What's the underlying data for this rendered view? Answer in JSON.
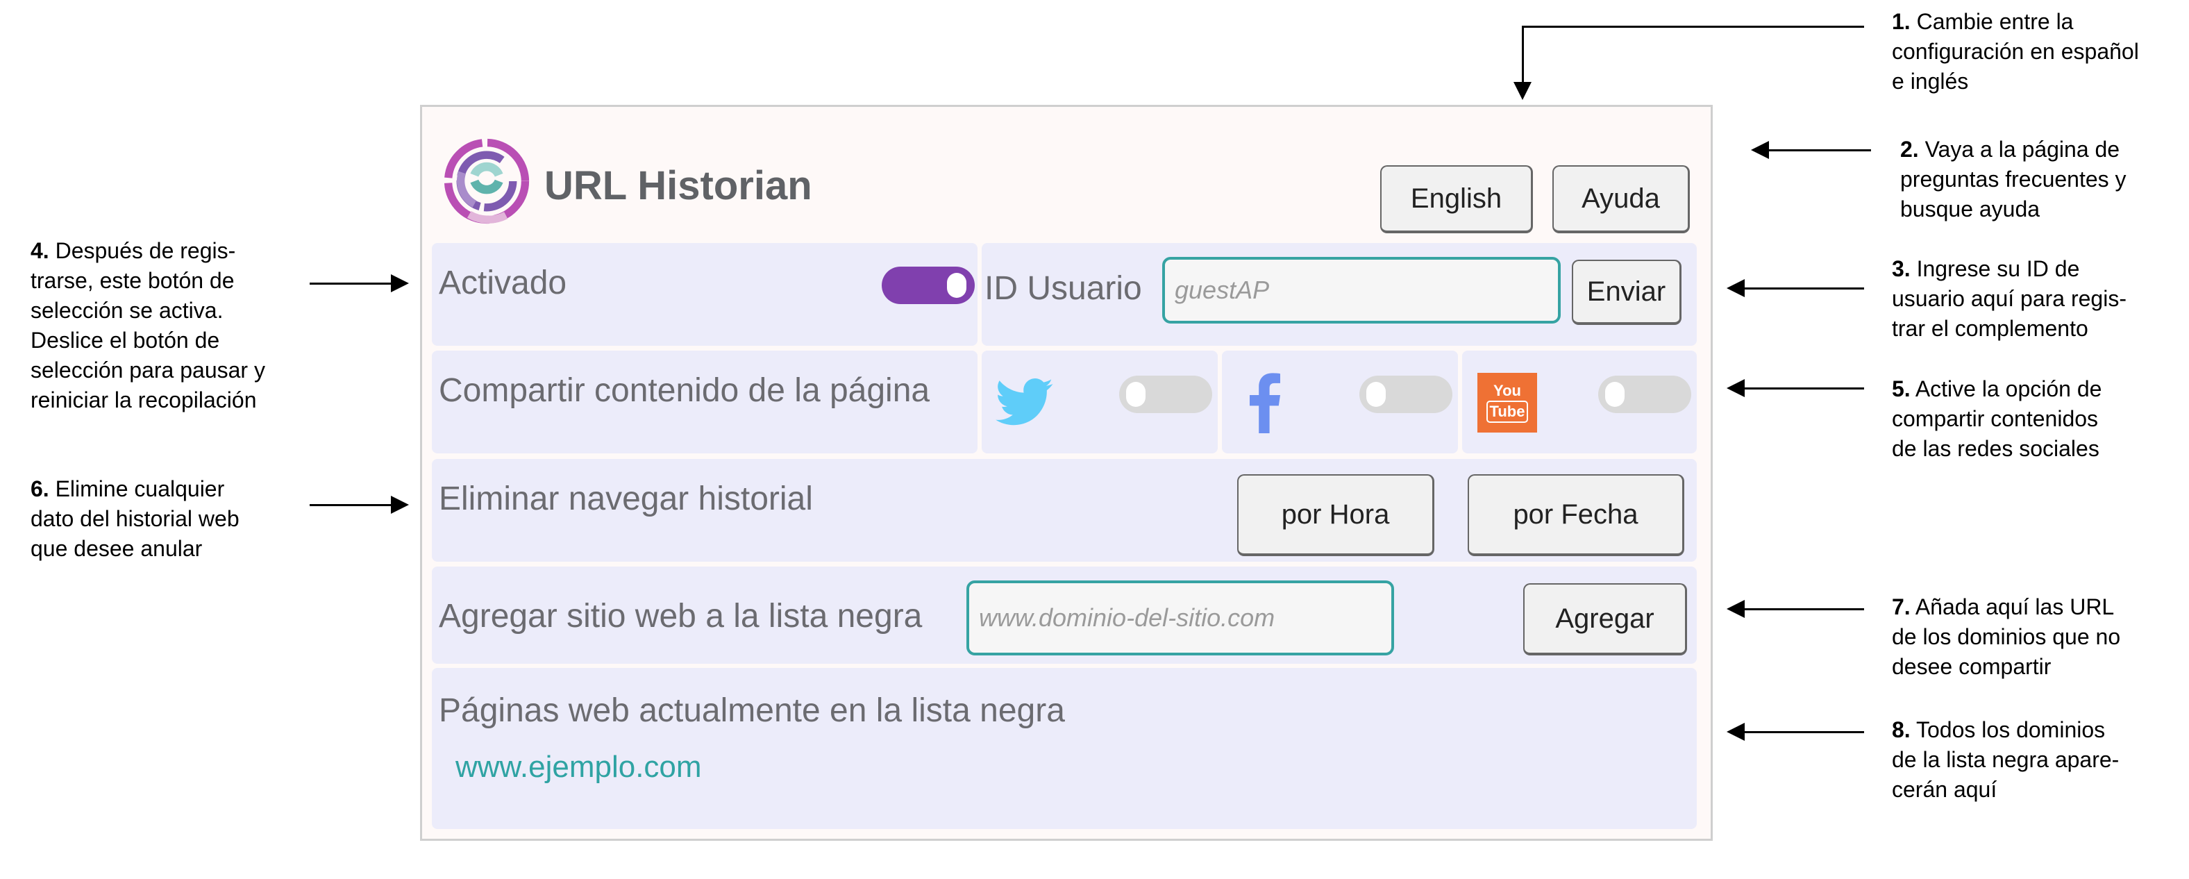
{
  "app": {
    "title": "URL Historian",
    "header_buttons": {
      "language": "English",
      "help": "Ayuda"
    }
  },
  "rows": {
    "activation": {
      "label": "Activado",
      "toggle_on": true
    },
    "user_id": {
      "label": "ID Usuario",
      "placeholder": "guestAP",
      "value": "",
      "submit": "Enviar"
    },
    "share": {
      "label": "Compartir contenido de la página",
      "networks": [
        {
          "name": "Twitter",
          "icon": "twitter-icon",
          "enabled": false
        },
        {
          "name": "Facebook",
          "icon": "facebook-icon",
          "enabled": false
        },
        {
          "name": "YouTube",
          "icon": "youtube-icon",
          "icon_text_top": "You",
          "icon_text_bottom": "Tube",
          "enabled": false
        }
      ]
    },
    "delete_history": {
      "label": "Eliminar navegar historial",
      "by_hour": "por Hora",
      "by_date": "por Fecha"
    },
    "blacklist_add": {
      "label": "Agregar sitio web a la lista negra",
      "placeholder": "www.dominio-del-sitio.com",
      "value": "",
      "button": "Agregar"
    },
    "blacklist_current": {
      "label": "Páginas web actualmente en la lista negra",
      "items": [
        "www.ejemplo.com"
      ]
    }
  },
  "annotations": [
    {
      "num": "1.",
      "lines": [
        "Cambie entre la",
        "configuración en español",
        "e inglés"
      ]
    },
    {
      "num": "2.",
      "lines": [
        "Vaya a la página de",
        "preguntas frecuentes y",
        "busque ayuda"
      ]
    },
    {
      "num": "3.",
      "lines": [
        "Ingrese su ID de",
        "usuario aquí para regis-",
        "trar el complemento"
      ]
    },
    {
      "num": "4.",
      "lines": [
        "Después de regis-",
        "trarse, este botón de",
        "selección se activa.",
        "Deslice el botón de",
        "selección para pausar y",
        "reiniciar la recopilación"
      ]
    },
    {
      "num": "5.",
      "lines": [
        "Active la opción de",
        "compartir contenidos",
        "de las redes sociales"
      ]
    },
    {
      "num": "6.",
      "lines": [
        "Elimine cualquier",
        "dato del historial web",
        "que desee anular"
      ]
    },
    {
      "num": "7.",
      "lines": [
        "Añada aquí las URL",
        "de los dominios que no",
        "desee compartir"
      ]
    },
    {
      "num": "8.",
      "lines": [
        "Todos los dominios",
        "de la lista negra apare-",
        "cerán aquí"
      ]
    }
  ],
  "colors": {
    "accent_purple": "#8040ae",
    "teal": "#36a3a3",
    "row_bg": "#ececfa",
    "header_bg": "#fef9f8",
    "twitter": "#5fcdf9",
    "facebook": "#6c8ff0",
    "youtube": "#ef7134"
  }
}
